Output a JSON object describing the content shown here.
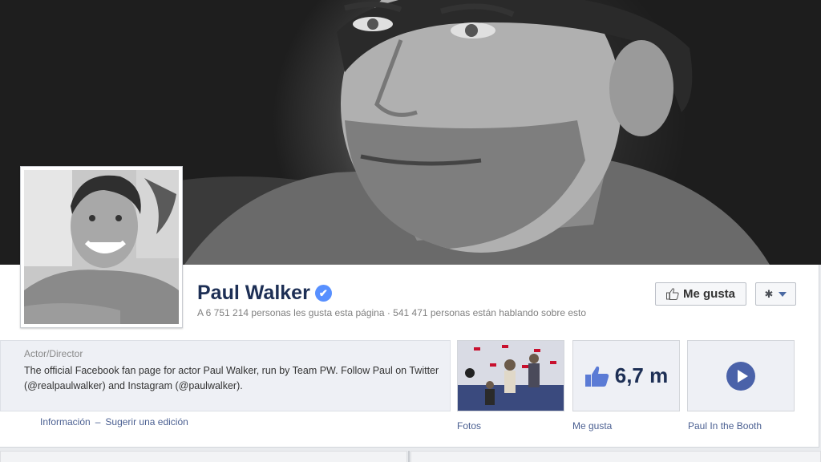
{
  "cover": {
    "alt": "cover-photo"
  },
  "profile": {
    "name": "Paul Walker",
    "verified": "✔",
    "stats": "A 6 751 214 personas les gusta esta página · 541 471 personas están hablando sobre esto"
  },
  "actions": {
    "like_label": "Me gusta",
    "settings_icon": "✱"
  },
  "about": {
    "category": "Actor/Director",
    "description": "The official Facebook fan page for actor Paul Walker, run by Team PW. Follow Paul on Twitter (@realpaulwalker) and Instagram (@paulwalker).",
    "info_link": "Información",
    "separator": "–",
    "suggest_link": "Sugerir una edición"
  },
  "apps": [
    {
      "label": "Fotos"
    },
    {
      "label": "Me gusta",
      "count": "6,7 m"
    },
    {
      "label": "Paul In the Booth"
    }
  ],
  "colors": {
    "brand_text": "#1d2f55",
    "link": "#4a5f91",
    "verified": "#5890ff",
    "play": "#4a62a9"
  }
}
